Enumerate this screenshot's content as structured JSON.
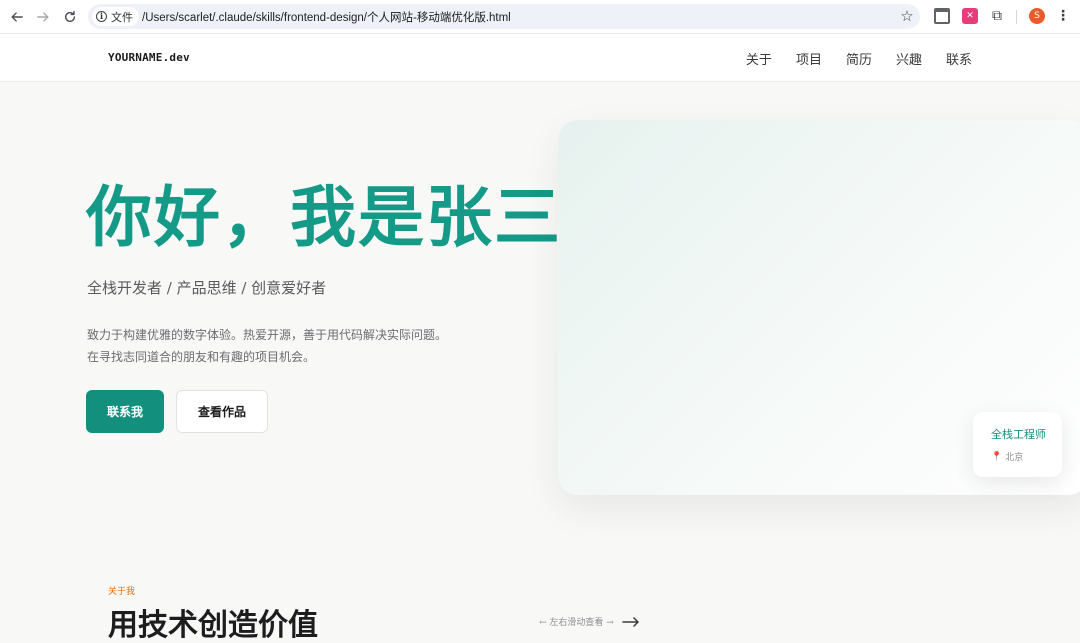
{
  "browser": {
    "chip_label": "文件",
    "url": "/Users/scarlet/.claude/skills/frontend-design/个人网站-移动端优化版.html",
    "profile_initial": "S"
  },
  "site": {
    "logo": "YOURNAME.dev",
    "nav": [
      "关于",
      "项目",
      "简历",
      "兴趣",
      "联系"
    ]
  },
  "hero": {
    "title": "你好，我是张三",
    "subtitle": "全栈开发者 / 产品思维 / 创意爱好者",
    "description": [
      "致力于构建优雅的数字体验。热爱开源，善于用代码解决实际问题。",
      "在寻找志同道合的朋友和有趣的项目机会。"
    ],
    "primary_button": "联系我",
    "secondary_button": "查看作品",
    "card": {
      "role": "全栈工程师",
      "location": "北京"
    }
  },
  "about": {
    "tag": "关于我",
    "title": "用技术创造价值",
    "scroll_hint": "← 左右滑动查看 →"
  },
  "colors": {
    "accent": "#159a88",
    "button": "#138f7e",
    "tag": "#e8710a"
  }
}
